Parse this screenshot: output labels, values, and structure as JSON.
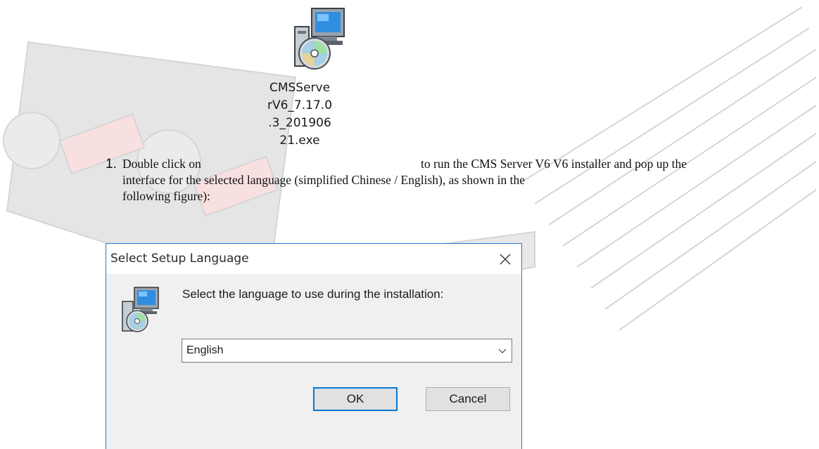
{
  "desktop_icon": {
    "label": "CMSServe\nrV6_7.17.0\n.3_201906\n21.exe",
    "icon": "installer-cd-icon"
  },
  "instruction": {
    "number": "1.",
    "line1_before": "Double click on",
    "line1_after": "to run the CMS Server V6 V6 installer and pop up the",
    "line2": "interface for the selected language (simplified Chinese / English), as shown in the",
    "line3": "following figure):"
  },
  "dialog": {
    "title": "Select Setup Language",
    "close_icon": "close-icon",
    "prompt": "Select the language to use during the installation:",
    "language_selected": "English",
    "ok_label": "OK",
    "cancel_label": "Cancel",
    "accent_color": "#0078d7"
  }
}
